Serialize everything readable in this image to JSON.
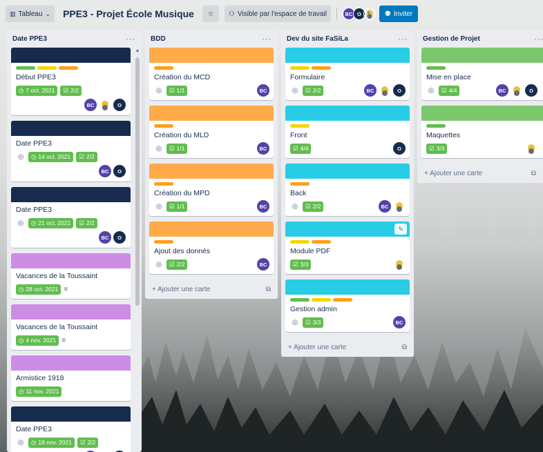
{
  "header": {
    "view_label": "Tableau",
    "board_title": "PPE3 - Projet École Musique",
    "visibility_label": "Visible par l'espace de travail",
    "members": [
      "BC",
      "O"
    ],
    "invite_label": "Inviter"
  },
  "colors": {
    "navy": "#172b4d",
    "orange": "#ffab4a",
    "cyan": "#29cce5",
    "green": "#61bd4f",
    "lightgreen": "#7bc86c",
    "purple": "#cd8de5",
    "yellow": "#f2d600",
    "label_orange": "#ff9f1a",
    "badge_green": "#61bd4f",
    "invite_blue": "#0079bf"
  },
  "avatars": {
    "bc": "BC",
    "o": "O"
  },
  "lists": [
    {
      "title": "Date PPE3",
      "cards": [
        {
          "title": "Début PPE3",
          "due": "7 oct. 2021",
          "checklist": "2/2"
        },
        {
          "title": "Date PPE3",
          "due": "14 oct. 2021",
          "checklist": "2/2"
        },
        {
          "title": "Date PPE3",
          "due": "21 oct. 2021",
          "checklist": "2/2"
        },
        {
          "title": "Vacances de la Toussaint",
          "due": "28 oct. 2021"
        },
        {
          "title": "Vacances de la Toussaint",
          "due": "4 nov. 2021"
        },
        {
          "title": "Armistice 1918",
          "due": "11 nov. 2021"
        },
        {
          "title": "Date PPE3",
          "due": "18 nov. 2021",
          "checklist": "2/2"
        }
      ]
    },
    {
      "title": "BDD",
      "cards": [
        {
          "title": "Création du MCD",
          "checklist": "1/1"
        },
        {
          "title": "Création du MLD",
          "checklist": "1/1"
        },
        {
          "title": "Création du MPD",
          "checklist": "1/1"
        },
        {
          "title": "Ajout des donnés",
          "checklist": "2/2"
        }
      ],
      "add_card": "Ajouter une carte"
    },
    {
      "title": "Dev du site FaSiLa",
      "cards": [
        {
          "title": "Formulaire",
          "checklist": "2/2"
        },
        {
          "title": "Front",
          "checklist": "4/4"
        },
        {
          "title": "Back",
          "checklist": "2/2"
        },
        {
          "title": "Module PDF",
          "checklist": "3/3"
        },
        {
          "title": "Gestion admin",
          "checklist": "3/3"
        }
      ],
      "add_card": "Ajouter une carte"
    },
    {
      "title": "Gestion de Projet",
      "cards": [
        {
          "title": "Mise en place",
          "checklist": "4/4"
        },
        {
          "title": "Maquettes",
          "checklist": "3/3"
        }
      ],
      "add_card": "Ajouter une carte"
    }
  ]
}
